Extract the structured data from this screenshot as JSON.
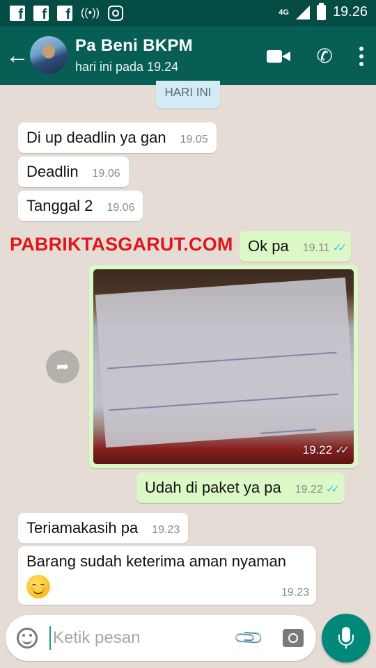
{
  "status_bar": {
    "notification_icons": [
      "facebook-icon",
      "facebook-icon",
      "facebook-icon",
      "hotspot-icon",
      "instagram-icon"
    ],
    "network": "4G",
    "time": "19.26"
  },
  "header": {
    "contact_name": "Pa Beni BKPM",
    "last_seen": "hari ini pada 19.24",
    "icons": [
      "back-arrow-icon",
      "video-call-icon",
      "phone-icon",
      "more-vert-icon"
    ]
  },
  "chat": {
    "date_chip": "HARI INI",
    "messages": [
      {
        "direction": "in",
        "text": "Di up deadlin ya gan",
        "time": "19.05"
      },
      {
        "direction": "in",
        "text": "Deadlin",
        "time": "19.06"
      },
      {
        "direction": "in",
        "text": "Tanggal 2",
        "time": "19.06"
      },
      {
        "direction": "out",
        "text": "Ok pa",
        "time": "19.11",
        "status": "read"
      },
      {
        "direction": "out",
        "type": "image",
        "time": "19.22",
        "status": "read"
      },
      {
        "direction": "out",
        "text": "Udah di paket ya pa",
        "time": "19.22",
        "status": "read"
      },
      {
        "direction": "in",
        "text": "Teriamakasih pa",
        "time": "19.23"
      },
      {
        "direction": "in",
        "text": "Barang sudah keterima aman nyaman",
        "time": "19.23",
        "emoji": "smiling-face-emoji"
      }
    ],
    "watermark": "PABRIKTASGARUT.COM"
  },
  "input": {
    "placeholder": "Ketik pesan",
    "value": ""
  },
  "colors": {
    "header": "#075e54",
    "status_bar": "#054d44",
    "outgoing_bubble": "#dcf8c6",
    "incoming_bubble": "#ffffff",
    "chat_background": "#e5ddd5",
    "read_ticks": "#4fc3f7",
    "mic_button": "#00897b",
    "watermark": "#e0161b"
  }
}
